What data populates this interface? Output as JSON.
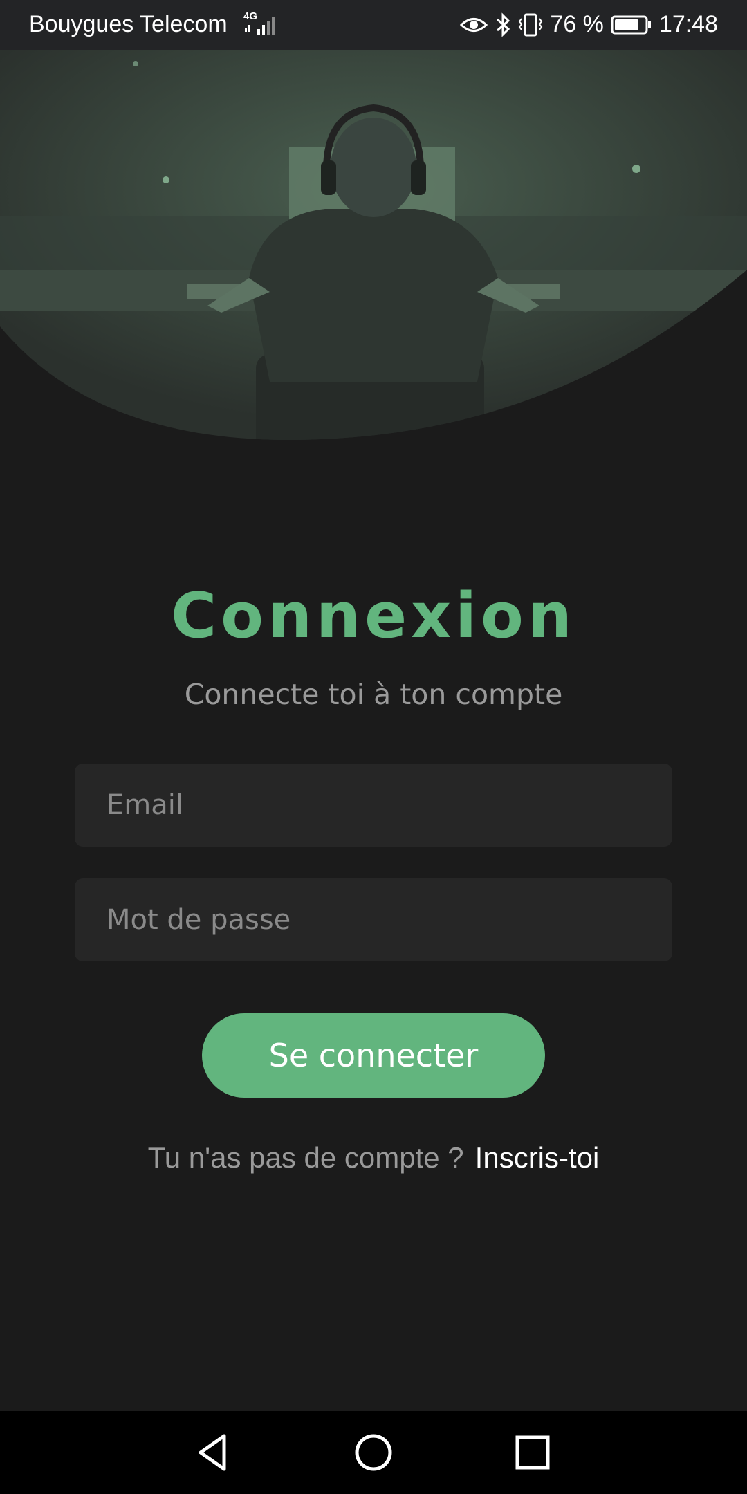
{
  "status_bar": {
    "carrier": "Bouygues Telecom",
    "network": "4G",
    "battery": "76 %",
    "time": "17:48",
    "icons": [
      "signal-icon",
      "eye-icon",
      "bluetooth-icon",
      "vibrate-icon",
      "battery-icon"
    ]
  },
  "hero": {
    "image": "gamer-at-desk-photo"
  },
  "login": {
    "title": "Connexion",
    "subtitle": "Connecte toi à ton compte",
    "email_placeholder": "Email",
    "password_placeholder": "Mot de passe",
    "submit_label": "Se connecter",
    "signup_prompt": "Tu n'as pas de compte ?",
    "signup_link": "Inscris-toi"
  },
  "nav_bar": {
    "icons": [
      "back-icon",
      "home-icon",
      "recents-icon"
    ]
  },
  "colors": {
    "accent": "#62b57e",
    "background": "#1b1b1b",
    "field": "#262626",
    "muted_text": "#9a9a9a"
  }
}
